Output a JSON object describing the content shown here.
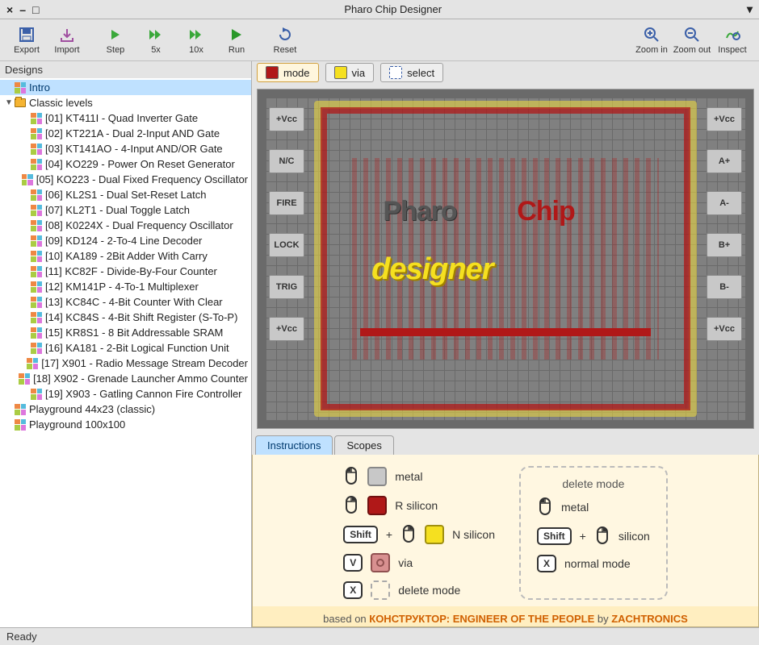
{
  "window": {
    "title": "Pharo Chip Designer"
  },
  "toolbar": {
    "export": "Export",
    "import": "Import",
    "step": "Step",
    "x5": "5x",
    "x10": "10x",
    "run": "Run",
    "reset": "Reset",
    "zoom_in": "Zoom in",
    "zoom_out": "Zoom out",
    "inspect": "Inspect"
  },
  "sidebar": {
    "title": "Designs",
    "intro": "Intro",
    "folder": "Classic levels",
    "levels": [
      "[01] KT411I - Quad Inverter Gate",
      "[02] KT221A - Dual 2-Input AND Gate",
      "[03] KT141AO - 4-Input AND/OR Gate",
      "[04] KO229 - Power On Reset Generator",
      "[05] KO223 - Dual Fixed Frequency Oscillator",
      "[06] KL2S1 - Dual Set-Reset Latch",
      "[07] KL2T1 - Dual Toggle Latch",
      "[08] K0224X - Dual Frequency Oscillator",
      "[09] KD124 - 2-To-4 Line Decoder",
      "[10] KA189 - 2Bit Adder With Carry",
      "[11] KC82F - Divide-By-Four Counter",
      "[12] KM141P - 4-To-1 Multiplexer",
      "[13] KC84C - 4-Bit Counter With Clear",
      "[14] KC84S - 4-Bit Shift Register (S-To-P)",
      "[15] KR8S1 - 8 Bit Addressable SRAM",
      "[16] KA181 - 2-Bit Logical Function Unit",
      "[17] X901 - Radio Message Stream Decoder",
      "[18] X902 - Grenade Launcher Ammo Counter",
      "[19] X903 - Gatling Cannon Fire Controller"
    ],
    "pg1": "Playground 44x23 (classic)",
    "pg2": "Playground 100x100"
  },
  "toolrow": {
    "mode": "mode",
    "via": "via",
    "select": "select"
  },
  "pads": {
    "left": [
      "+Vcc",
      "N/C",
      "FIRE",
      "LOCK",
      "TRIG",
      "+Vcc"
    ],
    "right": [
      "+Vcc",
      "A+",
      "A-",
      "B+",
      "B-",
      "+Vcc"
    ]
  },
  "logo": {
    "pharo": "Pharo",
    "chip": "Chip",
    "designer": "designer"
  },
  "tabs": {
    "instructions": "Instructions",
    "scopes": "Scopes"
  },
  "legend": {
    "metal": "metal",
    "r": "R silicon",
    "n": "N silicon",
    "via": "via",
    "delmode": "delete mode",
    "del_title": "delete mode",
    "del_metal": "metal",
    "del_silicon": "silicon",
    "del_normal": "normal mode",
    "shift": "Shift",
    "v": "V",
    "x": "X",
    "plus": "+"
  },
  "credits": {
    "pre": "based on ",
    "game": "КОНСТРУКТОР: ENGINEER OF THE PEOPLE",
    "mid": " by ",
    "author": "ZACHTRONICS"
  },
  "status": "Ready"
}
